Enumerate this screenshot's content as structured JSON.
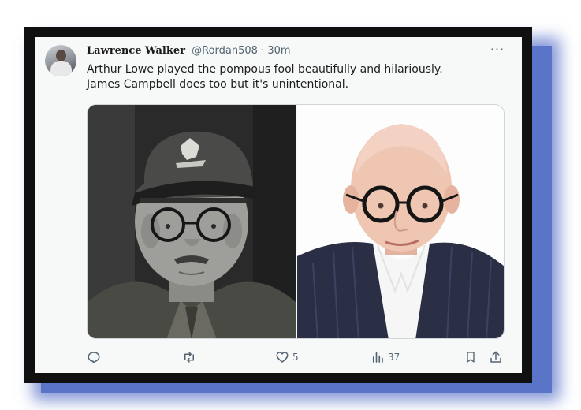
{
  "post": {
    "display_name": "Lawrence Walker",
    "handle": "@Rordan508",
    "separator": "·",
    "time": "30m",
    "text_line1": "Arthur Lowe played the pompous fool beautifully and hilariously.",
    "text_line2": "James Campbell does too but it's unintentional."
  },
  "actions": {
    "reply_icon": "reply-icon",
    "repost_icon": "repost-icon",
    "like_icon": "heart-icon",
    "like_count": "5",
    "views_icon": "views-icon",
    "views_count": "37",
    "bookmark_icon": "bookmark-icon",
    "share_icon": "share-icon"
  },
  "menu": {
    "more_icon": "more-icon",
    "label": "···"
  },
  "colors": {
    "card_bg": "#f7f8f8",
    "frame": "#101010",
    "shadow": "#5a74c8",
    "secondary_text": "#536471"
  }
}
